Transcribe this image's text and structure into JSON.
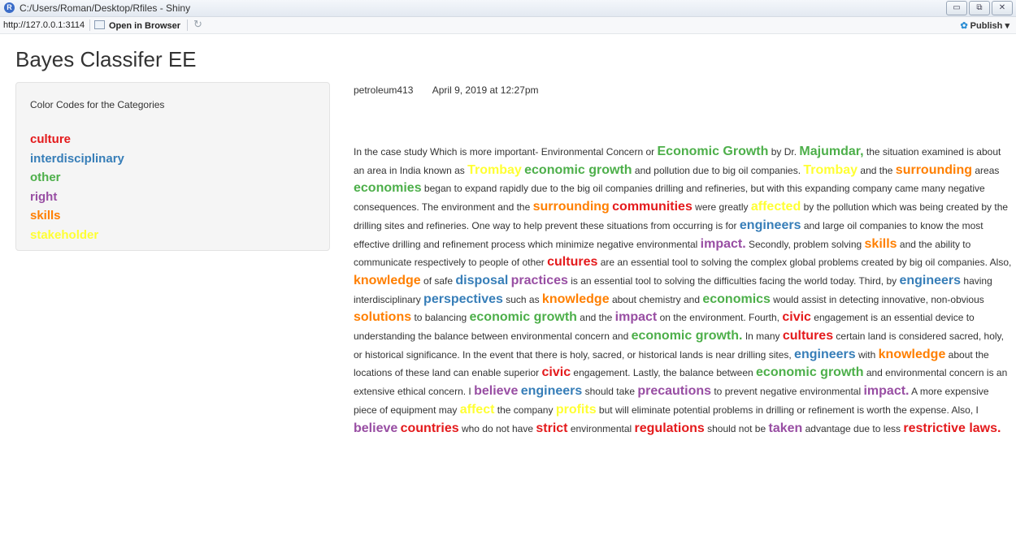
{
  "window": {
    "title": "C:/Users/Roman/Desktop/Rfiles - Shiny",
    "minimize_label": "▭",
    "restore_label": "⧉",
    "close_label": "✕"
  },
  "toolbar": {
    "url": "http://127.0.0.1:3114",
    "open_browser_label": "Open in Browser",
    "refresh_icon": "↻",
    "publish_icon": "✿",
    "publish_label": "Publish",
    "publish_caret": "▾"
  },
  "page": {
    "title": "Bayes Classifer EE"
  },
  "legend": {
    "heading": "Color Codes for the Categories",
    "items": [
      {
        "label": "culture",
        "color": "#e41a1c"
      },
      {
        "label": "interdisciplinary",
        "color": "#377eb8"
      },
      {
        "label": "other",
        "color": "#4daf4a"
      },
      {
        "label": "right",
        "color": "#984ea3"
      },
      {
        "label": "skills",
        "color": "#ff7f00"
      },
      {
        "label": "stakeholder",
        "color": "#ffff33"
      }
    ]
  },
  "post": {
    "author": "petroleum413",
    "date": "April 9, 2019 at 12:27pm"
  },
  "article": {
    "segments": [
      {
        "text": "In the case study        Which is more important- Environmental Concern or "
      },
      {
        "text": "Economic Growth",
        "cat": "other"
      },
      {
        "text": "          by Dr. "
      },
      {
        "text": "Majumdar,",
        "cat": "other"
      },
      {
        "text": " the situation examined is about an area in India known as "
      },
      {
        "text": "Trombay",
        "cat": "stakeholder"
      },
      {
        "text": " "
      },
      {
        "text": "economic growth",
        "cat": "other"
      },
      {
        "text": " and pollution due to big oil companies. "
      },
      {
        "text": "Trombay",
        "cat": "stakeholder"
      },
      {
        "text": " and the "
      },
      {
        "text": "surrounding",
        "cat": "skills"
      },
      {
        "text": " areas "
      },
      {
        "text": "economies",
        "cat": "other"
      },
      {
        "text": " began to expand rapidly due to the big oil companies drilling and refineries, but with this expanding company came many negative consequences. The environment and the "
      },
      {
        "text": "surrounding",
        "cat": "skills"
      },
      {
        "text": " "
      },
      {
        "text": "communities",
        "cat": "culture"
      },
      {
        "text": " were greatly "
      },
      {
        "text": "affected",
        "cat": "stakeholder"
      },
      {
        "text": " by the pollution which was being created by the drilling sites and refineries. One way to help prevent these situations from occurring is for "
      },
      {
        "text": "engineers",
        "cat": "interdisciplinary"
      },
      {
        "text": " and large oil companies to know the most effective drilling and refinement process which minimize negative environmental "
      },
      {
        "text": "impact.",
        "cat": "right"
      },
      {
        "text": " Secondly, problem solving "
      },
      {
        "text": "skills",
        "cat": "skills"
      },
      {
        "text": " and the ability to communicate respectively to people of other "
      },
      {
        "text": "cultures",
        "cat": "culture"
      },
      {
        "text": " are an essential tool to solving the complex global problems created by big oil companies. Also, "
      },
      {
        "text": "knowledge",
        "cat": "skills"
      },
      {
        "text": " of safe "
      },
      {
        "text": "disposal",
        "cat": "interdisciplinary"
      },
      {
        "text": " "
      },
      {
        "text": "practices",
        "cat": "right"
      },
      {
        "text": " is an essential tool to solving the difficulties facing the world today. Third, by "
      },
      {
        "text": "engineers",
        "cat": "interdisciplinary"
      },
      {
        "text": " having interdisciplinary "
      },
      {
        "text": "perspectives",
        "cat": "interdisciplinary"
      },
      {
        "text": " such as "
      },
      {
        "text": "knowledge",
        "cat": "skills"
      },
      {
        "text": " about chemistry and "
      },
      {
        "text": "economics",
        "cat": "other"
      },
      {
        "text": " would assist in detecting innovative, non-obvious "
      },
      {
        "text": "solutions",
        "cat": "skills"
      },
      {
        "text": " to balancing "
      },
      {
        "text": "economic growth",
        "cat": "other"
      },
      {
        "text": " and the "
      },
      {
        "text": "impact",
        "cat": "right"
      },
      {
        "text": " on the environment. Fourth, "
      },
      {
        "text": "civic",
        "cat": "culture"
      },
      {
        "text": " engagement is an essential device to understanding the balance between environmental concern and "
      },
      {
        "text": "economic growth.",
        "cat": "other"
      },
      {
        "text": " In many "
      },
      {
        "text": "cultures",
        "cat": "culture"
      },
      {
        "text": " certain land is considered sacred, holy, or historical significance. In the event that there is holy, sacred, or historical lands is near drilling sites, "
      },
      {
        "text": "engineers",
        "cat": "interdisciplinary"
      },
      {
        "text": " with "
      },
      {
        "text": "knowledge",
        "cat": "skills"
      },
      {
        "text": " about the locations of these land can enable superior "
      },
      {
        "text": "civic",
        "cat": "culture"
      },
      {
        "text": " engagement. Lastly, the balance between "
      },
      {
        "text": "economic growth",
        "cat": "other"
      },
      {
        "text": " and environmental concern is an extensive ethical concern. I "
      },
      {
        "text": "believe",
        "cat": "right"
      },
      {
        "text": " "
      },
      {
        "text": "engineers",
        "cat": "interdisciplinary"
      },
      {
        "text": " should take "
      },
      {
        "text": "precautions",
        "cat": "right"
      },
      {
        "text": " to prevent negative environmental "
      },
      {
        "text": "impact.",
        "cat": "right"
      },
      {
        "text": " A more expensive piece of equipment may "
      },
      {
        "text": "affect",
        "cat": "stakeholder"
      },
      {
        "text": " the company          "
      },
      {
        "text": "profits",
        "cat": "stakeholder"
      },
      {
        "text": " but will eliminate potential problems in drilling or refinement is worth the expense. Also, I "
      },
      {
        "text": "believe",
        "cat": "right"
      },
      {
        "text": " "
      },
      {
        "text": "countries",
        "cat": "culture"
      },
      {
        "text": " who do not have "
      },
      {
        "text": "strict",
        "cat": "culture"
      },
      {
        "text": " environmental "
      },
      {
        "text": "regulations",
        "cat": "culture"
      },
      {
        "text": " should not be "
      },
      {
        "text": "taken",
        "cat": "right"
      },
      {
        "text": " advantage due to less "
      },
      {
        "text": "restrictive laws.",
        "cat": "culture"
      }
    ]
  }
}
